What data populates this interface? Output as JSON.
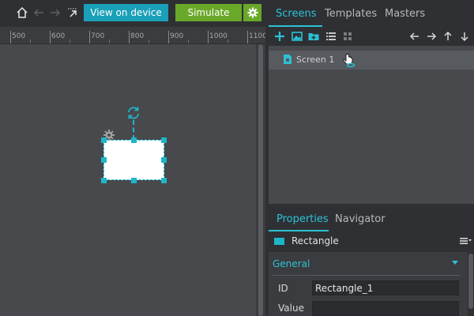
{
  "toolbar": {
    "view_on_device_label": "View on device",
    "simulate_label": "Simulate"
  },
  "ruler": {
    "labels": [
      "500",
      "600",
      "700",
      "800",
      "900",
      "1000",
      "1100"
    ]
  },
  "screens_panel": {
    "tabs": [
      {
        "label": "Screens",
        "active": true
      },
      {
        "label": "Templates",
        "active": false
      },
      {
        "label": "Masters",
        "active": false
      }
    ],
    "items": [
      {
        "label": "Screen 1",
        "selected": true
      }
    ]
  },
  "properties_panel": {
    "tabs": [
      {
        "label": "Properties",
        "active": true
      },
      {
        "label": "Navigator",
        "active": false
      }
    ],
    "element_type": "Rectangle",
    "section_title": "General",
    "fields": [
      {
        "label": "ID",
        "value": "Rectangle_1"
      },
      {
        "label": "Value",
        "value": ""
      }
    ]
  },
  "colors": {
    "accent": "#2cc2d4",
    "view_on_device_bg": "#1aa0b8",
    "simulate_bg": "#6aa82a",
    "panel_bg": "#2e3034",
    "canvas_bg": "#47494d"
  }
}
